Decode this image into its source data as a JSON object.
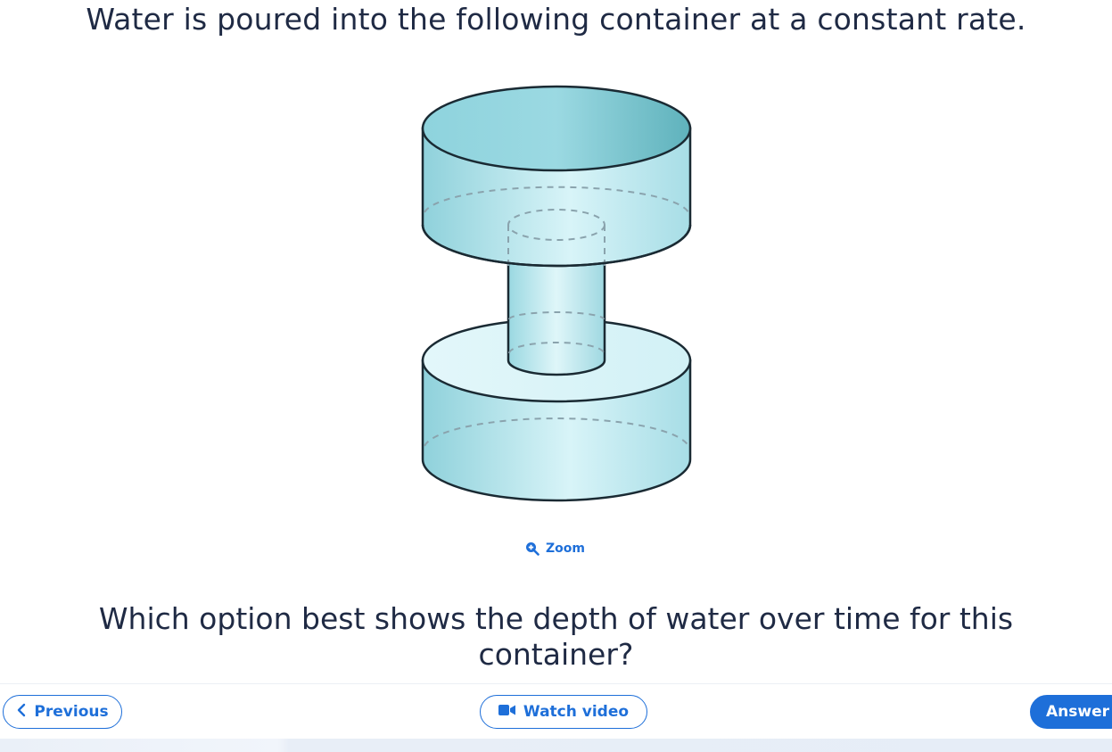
{
  "question": {
    "title": "Water is poured into the following container at a constant rate.",
    "prompt": "Which option best shows the depth of water over time for this container?"
  },
  "figure": {
    "zoom_label": "Zoom",
    "zoom_icon": "zoom-in-icon"
  },
  "footer": {
    "previous_label": "Previous",
    "previous_icon": "chevron-left-icon",
    "video_label": "Watch video",
    "video_icon": "video-camera-icon",
    "answer_label": "Answer"
  },
  "colors": {
    "accent": "#1e6fd9",
    "text": "#1f2a44",
    "container_fill_light": "#d6f3f8",
    "container_fill_dark": "#72c4cf"
  }
}
